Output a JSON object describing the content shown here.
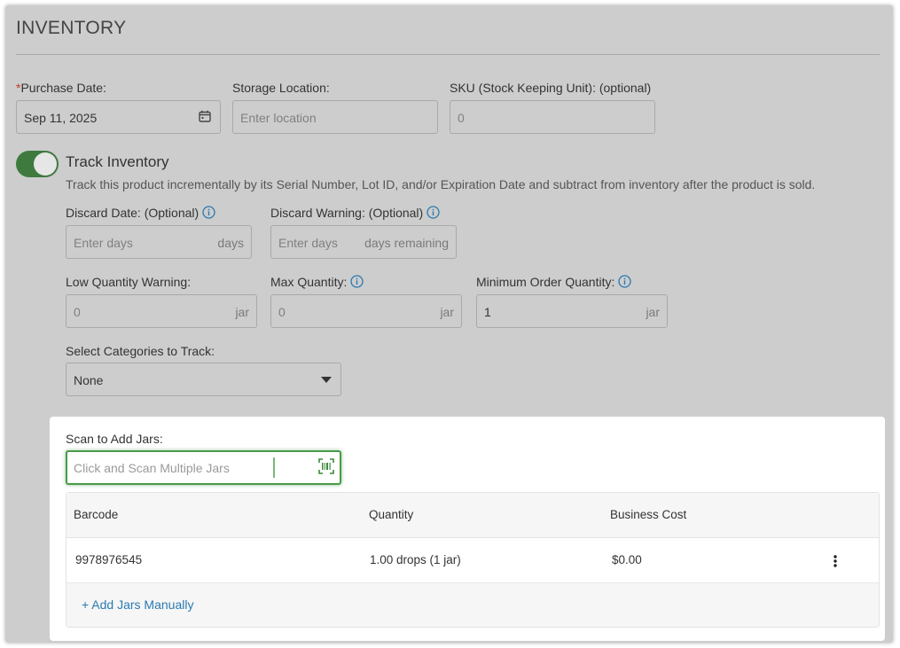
{
  "section_title": "INVENTORY",
  "purchase_date": {
    "required_mark": "*",
    "label": "Purchase Date:",
    "value": "Sep 11, 2025",
    "icon": "calendar-icon"
  },
  "storage_location": {
    "label": "Storage Location:",
    "placeholder": "Enter location"
  },
  "sku": {
    "label": "SKU (Stock Keeping Unit): (optional)",
    "value": "0"
  },
  "track_inventory": {
    "enabled": true,
    "title": "Track Inventory",
    "description": "Track this product incrementally by its Serial Number, Lot ID, and/or Expiration Date and subtract from inventory after the product is sold."
  },
  "discard_date": {
    "label": "Discard Date: (Optional)",
    "placeholder": "Enter days",
    "suffix": "days"
  },
  "discard_warning": {
    "label": "Discard Warning: (Optional)",
    "placeholder": "Enter days",
    "suffix": "days remaining"
  },
  "low_quantity": {
    "label": "Low Quantity Warning:",
    "value": "0",
    "suffix": "jar"
  },
  "max_quantity": {
    "label": "Max Quantity:",
    "value": "0",
    "suffix": "jar"
  },
  "min_order_quantity": {
    "label": "Minimum Order Quantity:",
    "value": "1",
    "suffix": "jar"
  },
  "categories": {
    "label": "Select Categories to Track:",
    "selected": "None"
  },
  "scan": {
    "label": "Scan to Add Jars:",
    "placeholder": "Click and Scan Multiple Jars",
    "icon": "barcode-scan-icon"
  },
  "table": {
    "headers": [
      "Barcode",
      "Quantity",
      "Business Cost"
    ],
    "rows": [
      {
        "barcode": "9978976545",
        "quantity": "1.00 drops (1 jar)",
        "business_cost": "$0.00"
      }
    ],
    "add_manually": "+ Add Jars Manually"
  },
  "colors": {
    "toggle_on": "#3e7a3e",
    "link": "#2a7ab0",
    "scan_focus": "#4a9a4a",
    "info": "#2a7ab0"
  }
}
